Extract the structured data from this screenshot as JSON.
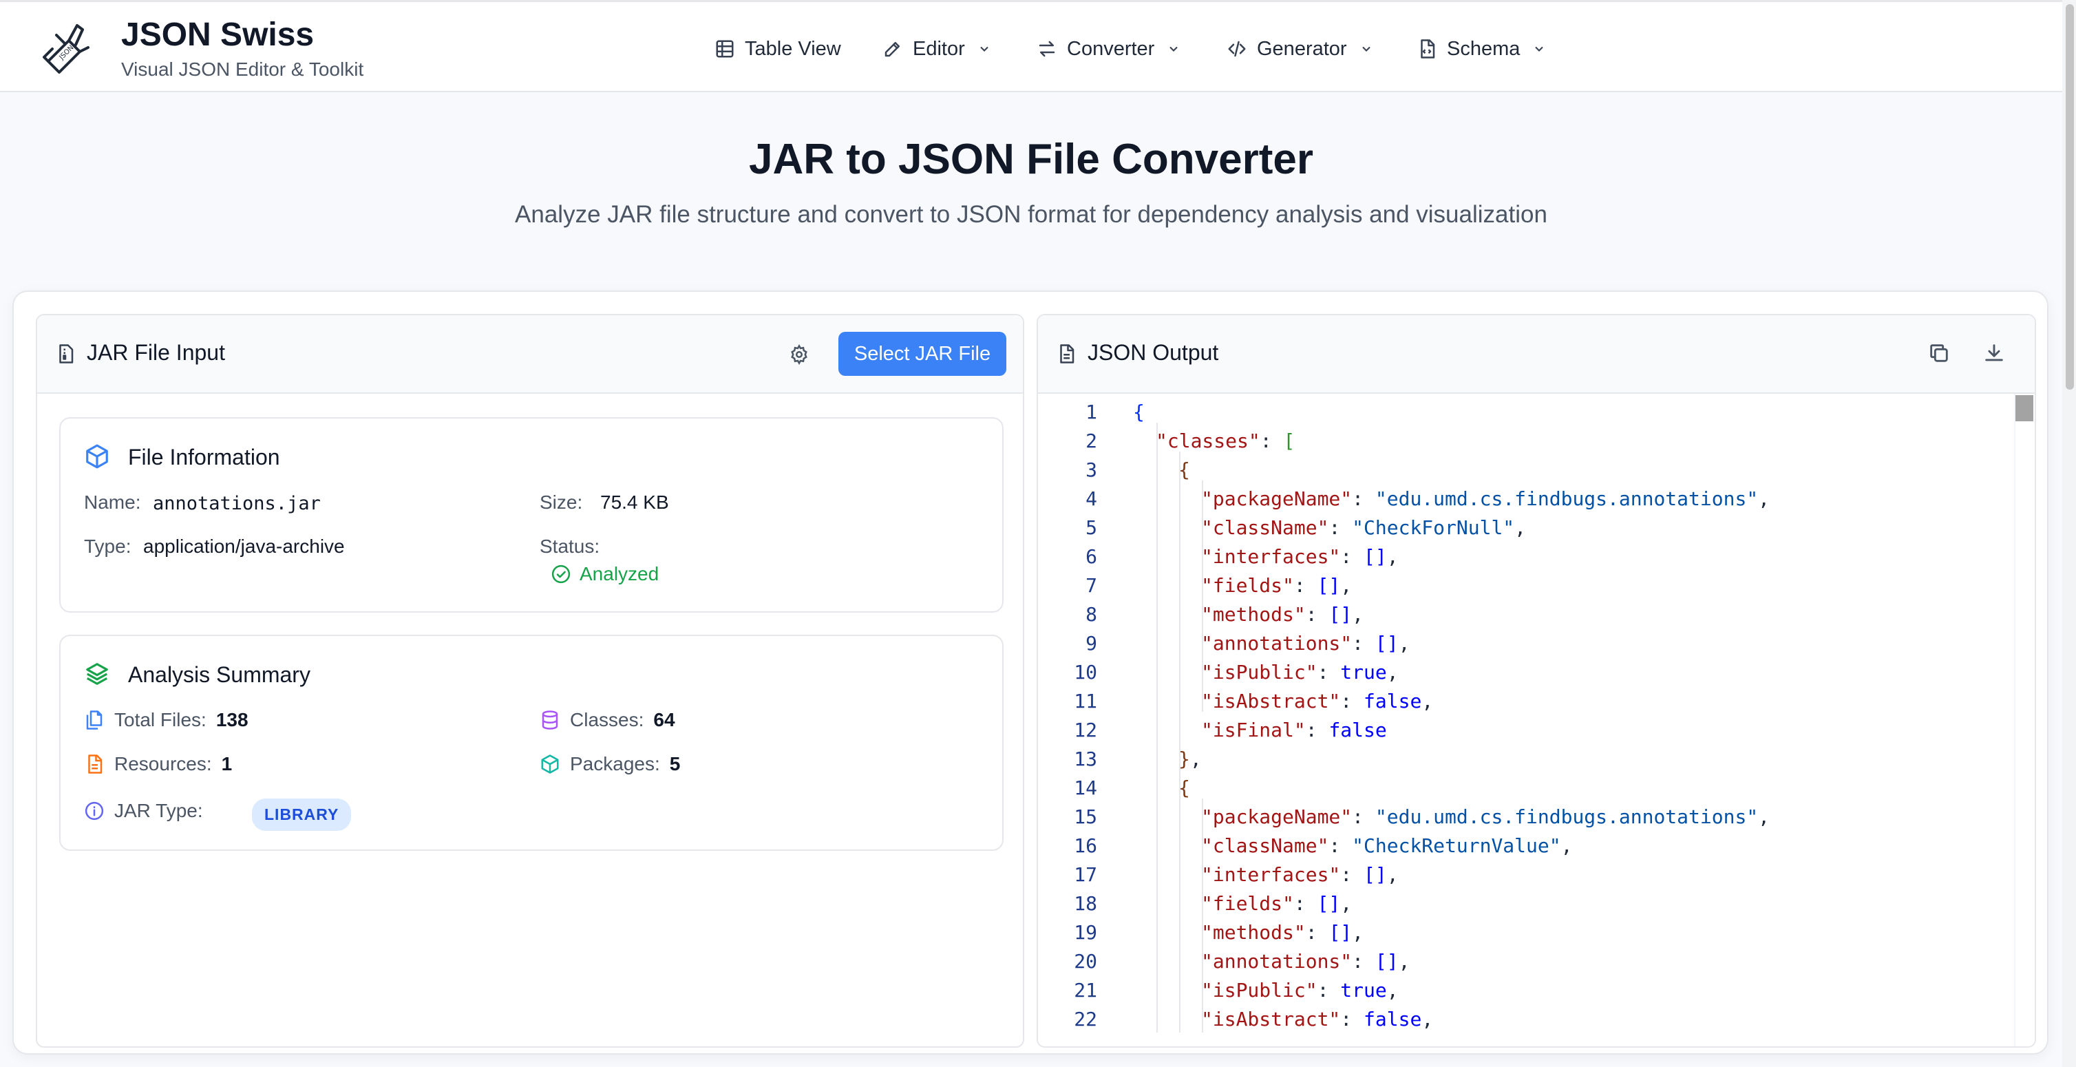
{
  "brand": {
    "title": "JSON Swiss",
    "subtitle": "Visual JSON Editor & Toolkit"
  },
  "nav": {
    "items": [
      {
        "label": "Table View",
        "icon": "table-icon",
        "dropdown": false
      },
      {
        "label": "Editor",
        "icon": "pencil-icon",
        "dropdown": true
      },
      {
        "label": "Converter",
        "icon": "swap-icon",
        "dropdown": true
      },
      {
        "label": "Generator",
        "icon": "code-icon",
        "dropdown": true
      },
      {
        "label": "Schema",
        "icon": "file-code-icon",
        "dropdown": true
      }
    ]
  },
  "hero": {
    "title": "JAR to JSON File Converter",
    "subtitle": "Analyze JAR file structure and convert to JSON format for dependency analysis and visualization"
  },
  "input_panel": {
    "title": "JAR File Input",
    "select_button": "Select JAR File",
    "file_info": {
      "title": "File Information",
      "name_label": "Name:",
      "name_value": "annotations.jar",
      "size_label": "Size:",
      "size_value": "75.4 KB",
      "type_label": "Type:",
      "type_value": "application/java-archive",
      "status_label": "Status:",
      "status_value": "Analyzed"
    },
    "summary": {
      "title": "Analysis Summary",
      "total_files_label": "Total Files:",
      "total_files_value": "138",
      "classes_label": "Classes:",
      "classes_value": "64",
      "resources_label": "Resources:",
      "resources_value": "1",
      "packages_label": "Packages:",
      "packages_value": "5",
      "jar_type_label": "JAR Type:",
      "jar_type_value": "LIBRARY"
    }
  },
  "output_panel": {
    "title": "JSON Output",
    "lines": [
      {
        "n": "1",
        "indent": 0,
        "tokens": [
          [
            "br1",
            "{"
          ]
        ]
      },
      {
        "n": "2",
        "indent": 1,
        "tokens": [
          [
            "k",
            "\"classes\""
          ],
          [
            "p",
            ": "
          ],
          [
            "br2",
            "["
          ]
        ]
      },
      {
        "n": "3",
        "indent": 2,
        "tokens": [
          [
            "br3",
            "{"
          ]
        ]
      },
      {
        "n": "4",
        "indent": 3,
        "tokens": [
          [
            "k",
            "\"packageName\""
          ],
          [
            "p",
            ": "
          ],
          [
            "s",
            "\"edu.umd.cs.findbugs.annotations\""
          ],
          [
            "p",
            ","
          ]
        ]
      },
      {
        "n": "5",
        "indent": 3,
        "tokens": [
          [
            "k",
            "\"className\""
          ],
          [
            "p",
            ": "
          ],
          [
            "s",
            "\"CheckForNull\""
          ],
          [
            "p",
            ","
          ]
        ]
      },
      {
        "n": "6",
        "indent": 3,
        "tokens": [
          [
            "k",
            "\"interfaces\""
          ],
          [
            "p",
            ": "
          ],
          [
            "b",
            "[]"
          ],
          [
            "p",
            ","
          ]
        ]
      },
      {
        "n": "7",
        "indent": 3,
        "tokens": [
          [
            "k",
            "\"fields\""
          ],
          [
            "p",
            ": "
          ],
          [
            "b",
            "[]"
          ],
          [
            "p",
            ","
          ]
        ]
      },
      {
        "n": "8",
        "indent": 3,
        "tokens": [
          [
            "k",
            "\"methods\""
          ],
          [
            "p",
            ": "
          ],
          [
            "b",
            "[]"
          ],
          [
            "p",
            ","
          ]
        ]
      },
      {
        "n": "9",
        "indent": 3,
        "tokens": [
          [
            "k",
            "\"annotations\""
          ],
          [
            "p",
            ": "
          ],
          [
            "b",
            "[]"
          ],
          [
            "p",
            ","
          ]
        ]
      },
      {
        "n": "10",
        "indent": 3,
        "tokens": [
          [
            "k",
            "\"isPublic\""
          ],
          [
            "p",
            ": "
          ],
          [
            "b",
            "true"
          ],
          [
            "p",
            ","
          ]
        ]
      },
      {
        "n": "11",
        "indent": 3,
        "tokens": [
          [
            "k",
            "\"isAbstract\""
          ],
          [
            "p",
            ": "
          ],
          [
            "b",
            "false"
          ],
          [
            "p",
            ","
          ]
        ]
      },
      {
        "n": "12",
        "indent": 3,
        "tokens": [
          [
            "k",
            "\"isFinal\""
          ],
          [
            "p",
            ": "
          ],
          [
            "b",
            "false"
          ]
        ]
      },
      {
        "n": "13",
        "indent": 2,
        "tokens": [
          [
            "br3",
            "}"
          ],
          [
            "p",
            ","
          ]
        ]
      },
      {
        "n": "14",
        "indent": 2,
        "tokens": [
          [
            "br3",
            "{"
          ]
        ]
      },
      {
        "n": "15",
        "indent": 3,
        "tokens": [
          [
            "k",
            "\"packageName\""
          ],
          [
            "p",
            ": "
          ],
          [
            "s",
            "\"edu.umd.cs.findbugs.annotations\""
          ],
          [
            "p",
            ","
          ]
        ]
      },
      {
        "n": "16",
        "indent": 3,
        "tokens": [
          [
            "k",
            "\"className\""
          ],
          [
            "p",
            ": "
          ],
          [
            "s",
            "\"CheckReturnValue\""
          ],
          [
            "p",
            ","
          ]
        ]
      },
      {
        "n": "17",
        "indent": 3,
        "tokens": [
          [
            "k",
            "\"interfaces\""
          ],
          [
            "p",
            ": "
          ],
          [
            "b",
            "[]"
          ],
          [
            "p",
            ","
          ]
        ]
      },
      {
        "n": "18",
        "indent": 3,
        "tokens": [
          [
            "k",
            "\"fields\""
          ],
          [
            "p",
            ": "
          ],
          [
            "b",
            "[]"
          ],
          [
            "p",
            ","
          ]
        ]
      },
      {
        "n": "19",
        "indent": 3,
        "tokens": [
          [
            "k",
            "\"methods\""
          ],
          [
            "p",
            ": "
          ],
          [
            "b",
            "[]"
          ],
          [
            "p",
            ","
          ]
        ]
      },
      {
        "n": "20",
        "indent": 3,
        "tokens": [
          [
            "k",
            "\"annotations\""
          ],
          [
            "p",
            ": "
          ],
          [
            "b",
            "[]"
          ],
          [
            "p",
            ","
          ]
        ]
      },
      {
        "n": "21",
        "indent": 3,
        "tokens": [
          [
            "k",
            "\"isPublic\""
          ],
          [
            "p",
            ": "
          ],
          [
            "b",
            "true"
          ],
          [
            "p",
            ","
          ]
        ]
      },
      {
        "n": "22",
        "indent": 3,
        "tokens": [
          [
            "k",
            "\"isAbstract\""
          ],
          [
            "p",
            ": "
          ],
          [
            "b",
            "false"
          ],
          [
            "p",
            ","
          ]
        ]
      }
    ]
  },
  "colors": {
    "accent": "#3b82f6",
    "success": "#16a34a",
    "json_key": "#a31515",
    "json_string": "#0451a5",
    "json_literal": "#0000ff"
  }
}
